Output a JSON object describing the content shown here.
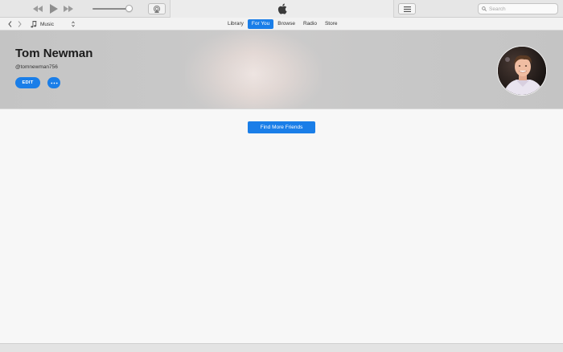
{
  "toolbar": {
    "search_placeholder": "Search"
  },
  "navbar": {
    "media_kind": "Music",
    "tabs": [
      {
        "label": "Library",
        "active": false
      },
      {
        "label": "For You",
        "active": true
      },
      {
        "label": "Browse",
        "active": false
      },
      {
        "label": "Radio",
        "active": false
      },
      {
        "label": "Store",
        "active": false
      }
    ]
  },
  "profile": {
    "name": "Tom Newman",
    "handle": "@tomnewman756",
    "edit_label": "EDIT"
  },
  "main": {
    "find_friends_label": "Find More Friends"
  },
  "icons": {
    "rewind": "rewind-icon",
    "play": "play-icon",
    "fast_forward": "fast-forward-icon",
    "airplay": "airplay-icon",
    "apple": "apple-logo-icon",
    "list": "list-icon",
    "search": "search-icon",
    "back": "chevron-left-icon",
    "forward": "chevron-right-icon",
    "music_note": "music-note-icon",
    "more": "ellipsis-icon"
  },
  "colors": {
    "accent": "#1a7ee8",
    "toolbar_bg": "#e6e6e6",
    "content_bg": "#f7f7f7",
    "header_bg": "#c8c8c8"
  },
  "volume_level": 0.9
}
